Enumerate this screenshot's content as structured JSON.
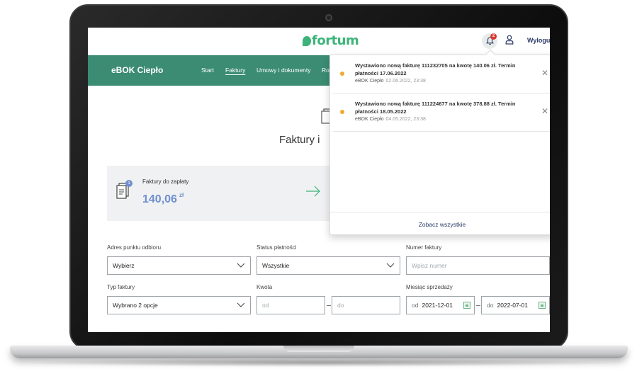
{
  "header": {
    "logo": "fortum",
    "notifications_count": "2",
    "logout_label": "Wyloguj"
  },
  "nav": {
    "brand": "eBOK Ciepło",
    "items": [
      {
        "label": "Start"
      },
      {
        "label": "Faktury",
        "active": true
      },
      {
        "label": "Umowy i dokumenty"
      },
      {
        "label": "Ro"
      }
    ]
  },
  "page": {
    "title": "Faktury i"
  },
  "summary_card": {
    "label": "Faktury do zapłaty",
    "badge": "1",
    "amount": "140,06",
    "currency": "zł"
  },
  "filters": {
    "address": {
      "label": "Adres punktu odbioru",
      "value": "Wybierz"
    },
    "payment_status": {
      "label": "Status płatności",
      "value": "Wszystkie"
    },
    "invoice_number": {
      "label": "Numer faktury",
      "placeholder": "Wpisz numer"
    },
    "invoice_type": {
      "label": "Typ faktury",
      "value": "Wybrano 2 opcje"
    },
    "amount": {
      "label": "Kwota",
      "from_placeholder": "od",
      "to_placeholder": "do"
    },
    "sale_month": {
      "label": "Miesiąc sprzedaży",
      "from_prefix": "od",
      "from_value": "2021-12-01",
      "to_prefix": "do",
      "to_value": "2022-07-01"
    }
  },
  "notifications": {
    "items": [
      {
        "text": "Wystawiono nową fakturę 111232705 na kwotę 140.06 zł. Termin płatności 17.06.2022",
        "source": "eBOK Ciepło",
        "date": "02.06.2022, 23:38"
      },
      {
        "text": "Wystawiono nową fakturę 111224677 na kwotę 378.88 zł. Termin płatności 18.05.2022",
        "source": "eBOK Ciepło",
        "date": "04.05.2022, 23:38"
      }
    ],
    "see_all": "Zobacz wszystkie"
  },
  "colors": {
    "brand_green": "#3db37a",
    "nav_green": "#3b8c73",
    "accent_blue": "#6f8fd0",
    "unread_dot": "#f0a830"
  }
}
